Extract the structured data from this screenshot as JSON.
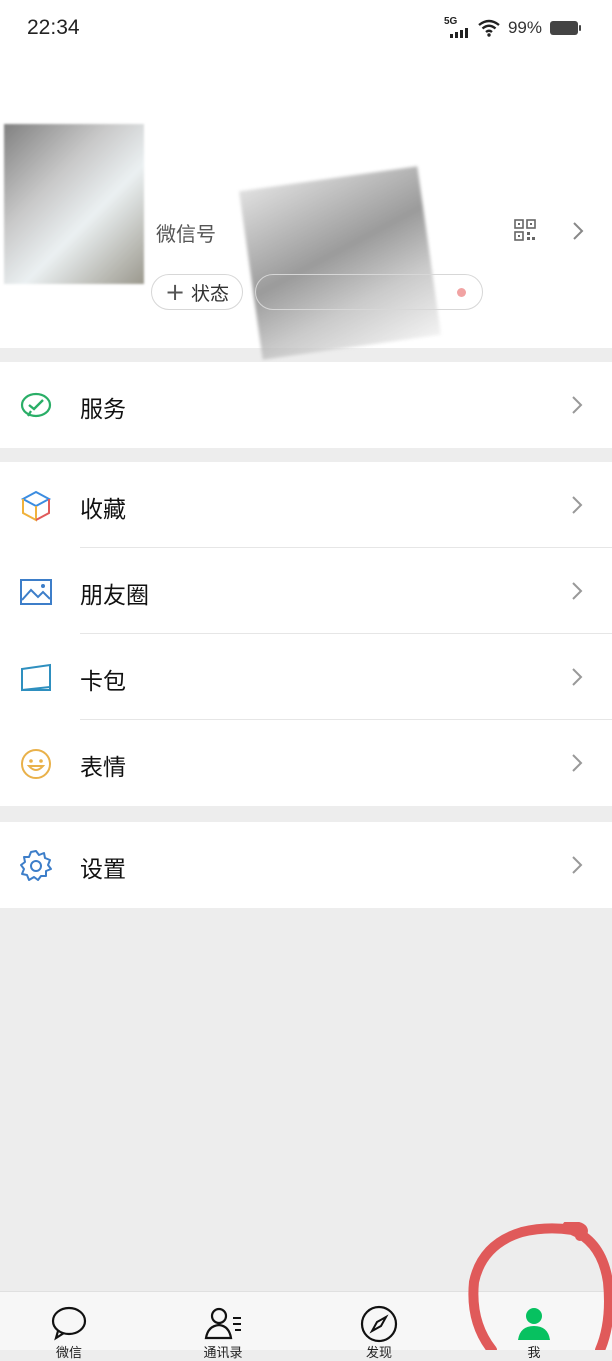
{
  "status_bar": {
    "time": "22:34",
    "network": "5G",
    "battery_percent": "99%"
  },
  "profile": {
    "wechat_id_label": "微信号",
    "status_button_label": "状态"
  },
  "menu_groups": [
    {
      "items": [
        {
          "label": "服务",
          "icon": "service-icon"
        }
      ]
    },
    {
      "items": [
        {
          "label": "收藏",
          "icon": "favorites-icon"
        },
        {
          "label": "朋友圈",
          "icon": "moments-icon"
        },
        {
          "label": "卡包",
          "icon": "card-wallet-icon"
        },
        {
          "label": "表情",
          "icon": "sticker-icon"
        }
      ]
    },
    {
      "items": [
        {
          "label": "设置",
          "icon": "settings-icon"
        }
      ]
    }
  ],
  "tabbar": {
    "tabs": [
      {
        "icon": "chats-icon",
        "label": "微信"
      },
      {
        "icon": "contacts-icon",
        "label": "通讯录"
      },
      {
        "icon": "discover-icon",
        "label": "发现"
      },
      {
        "icon": "me-icon",
        "label": "我",
        "active": true
      }
    ]
  },
  "colors": {
    "accent": "#07c160",
    "annotation": "#e05a5a"
  }
}
